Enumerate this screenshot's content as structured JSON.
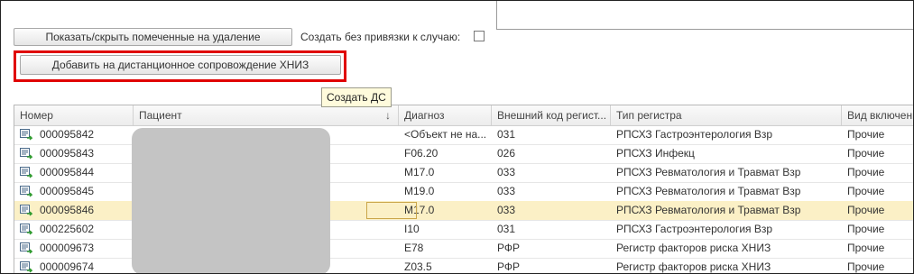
{
  "toolbar": {
    "show_hide_label": "Показать/скрыть помеченные на удаление",
    "no_case_label": "Создать без привязки к случаю:",
    "add_label": "Добавить на дистанционное сопровождение ХНИЗ",
    "tooltip": "Создать ДС"
  },
  "table": {
    "columns": [
      "Номер",
      "Пациент",
      "Диагноз",
      "Внешний код регист...",
      "Тип регистра",
      "Вид включени"
    ],
    "rows": [
      {
        "number": "000095842",
        "diagnosis": "<Объект не на...",
        "code": "031",
        "registry": "РПСХЗ Гастроэнтерология Взр",
        "kind": "Прочие"
      },
      {
        "number": "000095843",
        "diagnosis": "F06.20",
        "code": "026",
        "registry": "РПСХЗ Инфекц",
        "kind": "Прочие"
      },
      {
        "number": "000095844",
        "diagnosis": "M17.0",
        "code": "033",
        "registry": "РПСХЗ Ревматология и Травмат Взр",
        "kind": "Прочие"
      },
      {
        "number": "000095845",
        "diagnosis": "M19.0",
        "code": "033",
        "registry": "РПСХЗ Ревматология и Травмат Взр",
        "kind": "Прочие"
      },
      {
        "number": "000095846",
        "diagnosis": "M17.0",
        "code": "033",
        "registry": "РПСХЗ Ревматология и Травмат Взр",
        "kind": "Прочие"
      },
      {
        "number": "000225602",
        "diagnosis": "I10",
        "code": "031",
        "registry": "РПСХЗ Гастроэнтерология Взр",
        "kind": "Прочие"
      },
      {
        "number": "000009673",
        "diagnosis": "E78",
        "code": "РФР",
        "registry": "Регистр факторов риска ХНИЗ",
        "kind": "Прочие"
      },
      {
        "number": "000009674",
        "diagnosis": "Z03.5",
        "code": "РФР",
        "registry": "Регистр факторов риска ХНИЗ",
        "kind": "Прочие"
      }
    ],
    "selected_row": 4
  },
  "colors": {
    "selection": "#fbf0c6",
    "highlight": "#e00000",
    "tooltip_bg": "#fffbdc"
  },
  "icons": {
    "row_icon": "document-arrow-icon",
    "sort": "sort-down-arrow-icon"
  }
}
